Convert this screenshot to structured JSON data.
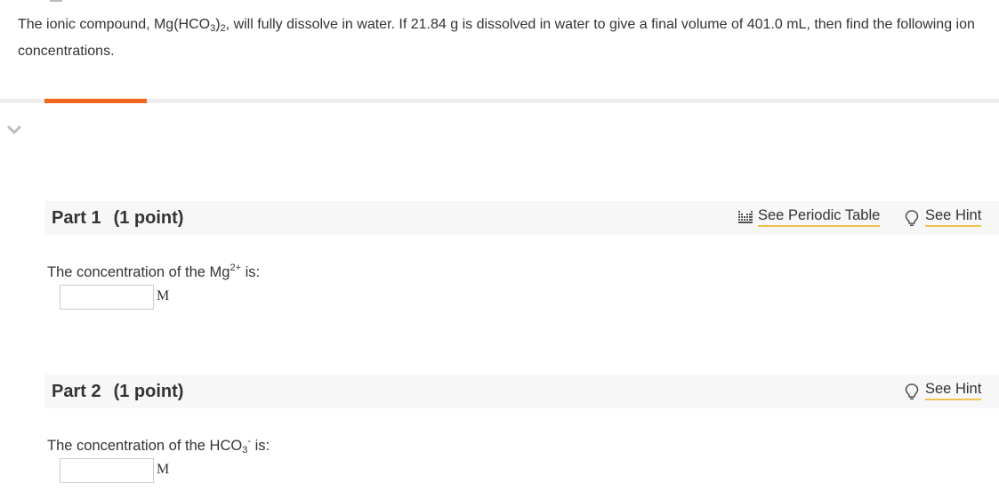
{
  "question": {
    "t1": "The ionic compound, Mg(HCO",
    "s1": "3",
    "t2": ")",
    "s2": "2",
    "t3": ", will fully dissolve in water. If 21.84 g is dissolved in water to give a final volume of 401.0 mL, then find the following ion concentrations."
  },
  "colors": {
    "accent": "#f26522",
    "link_underline": "#f2c14e",
    "header_bg": "#f7f7f7"
  },
  "icons": {
    "collapse": "chevron-down-icon",
    "periodic_table": "periodic-table-icon",
    "hint": "lightbulb-icon"
  },
  "parts": [
    {
      "title": "Part 1",
      "points": "(1 point)",
      "periodic_table_label": "See Periodic Table",
      "hint_label": "See Hint",
      "prompt": {
        "before": "The concentration of the Mg",
        "sup": "2+",
        "sub": "",
        "after": " is:"
      },
      "answer_value": "",
      "unit": "M"
    },
    {
      "title": "Part 2",
      "points": "(1 point)",
      "hint_label": "See Hint",
      "prompt": {
        "before": "The concentration of the HCO",
        "sub": "3",
        "sup": "-",
        "after": " is:"
      },
      "answer_value": "",
      "unit": "M"
    }
  ]
}
